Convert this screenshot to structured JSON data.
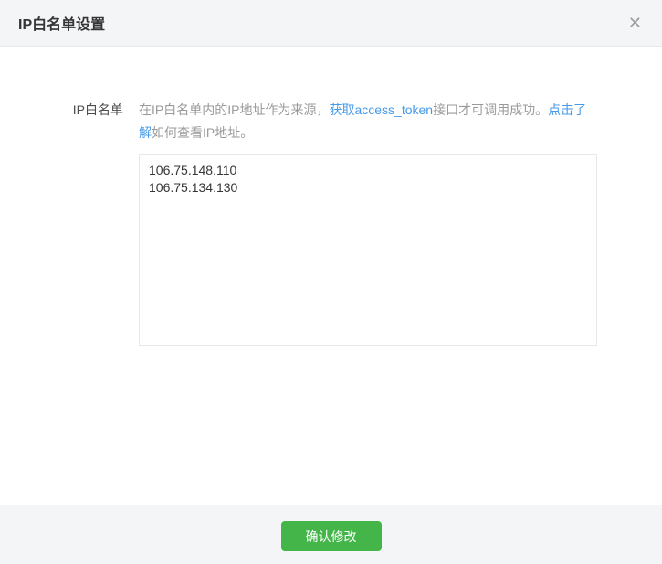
{
  "dialog": {
    "title": "IP白名单设置",
    "close_icon": "✕"
  },
  "form": {
    "label": "IP白名单",
    "description": {
      "part1": "在IP白名单内的IP地址作为来源，",
      "link_get_token": "获取access_token",
      "part2": "接口才可调用成功。",
      "link_learn": "点击了解",
      "part3": "如何查看IP地址。"
    },
    "whitelist_value": "106.75.148.110\n106.75.134.130"
  },
  "footer": {
    "confirm_label": "确认修改"
  },
  "colors": {
    "accent_green": "#44b549",
    "link_blue": "#459ae9",
    "panel_gray": "#f4f5f7",
    "border_gray": "#e7e7eb",
    "text_gray": "#9a9a9a",
    "text_dark": "#353535"
  }
}
